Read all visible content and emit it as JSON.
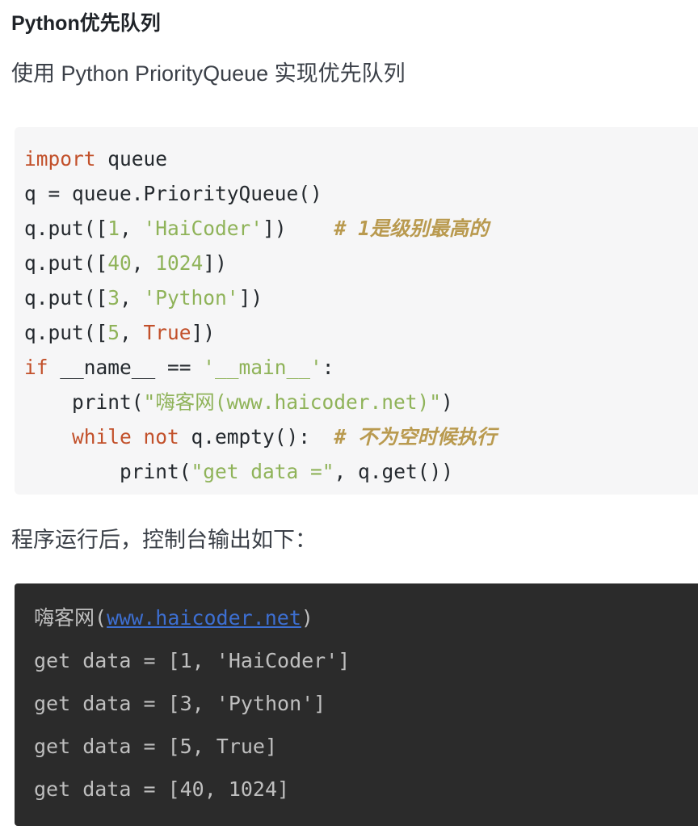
{
  "article": {
    "title": "Python优先队列",
    "lead": "使用 Python PriorityQueue 实现优先队列",
    "run_note": "程序运行后，控制台输出如下："
  },
  "code_block": {
    "language": "python",
    "background": "#f6f6f7",
    "colors": {
      "keyword": "#c2502a",
      "string": "#8fb359",
      "number": "#8fb359",
      "comment": "#b99a4f",
      "plain": "#24292e"
    },
    "lines": [
      {
        "index": 1,
        "text": "import queue",
        "tokens": [
          {
            "t": "import",
            "k": "kw"
          },
          {
            "t": " queue",
            "k": "pln"
          }
        ]
      },
      {
        "index": 2,
        "text": "q = queue.PriorityQueue()",
        "tokens": [
          {
            "t": "q = queue.PriorityQueue()",
            "k": "pln"
          }
        ]
      },
      {
        "index": 3,
        "text": "q.put([1, 'HaiCoder'])    # 1是级别最高的",
        "tokens": [
          {
            "t": "q.put([",
            "k": "pln"
          },
          {
            "t": "1",
            "k": "num"
          },
          {
            "t": ", ",
            "k": "pln"
          },
          {
            "t": "'HaiCoder'",
            "k": "str"
          },
          {
            "t": "])",
            "k": "pln"
          },
          {
            "t": "    ",
            "k": "pln"
          },
          {
            "t": "# 1是级别最高的",
            "k": "com"
          }
        ]
      },
      {
        "index": 4,
        "text": "q.put([40, 1024])",
        "tokens": [
          {
            "t": "q.put([",
            "k": "pln"
          },
          {
            "t": "40",
            "k": "num"
          },
          {
            "t": ", ",
            "k": "pln"
          },
          {
            "t": "1024",
            "k": "num"
          },
          {
            "t": "])",
            "k": "pln"
          }
        ]
      },
      {
        "index": 5,
        "text": "q.put([3, 'Python'])",
        "tokens": [
          {
            "t": "q.put([",
            "k": "pln"
          },
          {
            "t": "3",
            "k": "num"
          },
          {
            "t": ", ",
            "k": "pln"
          },
          {
            "t": "'Python'",
            "k": "str"
          },
          {
            "t": "])",
            "k": "pln"
          }
        ]
      },
      {
        "index": 6,
        "text": "q.put([5, True])",
        "tokens": [
          {
            "t": "q.put([",
            "k": "pln"
          },
          {
            "t": "5",
            "k": "num"
          },
          {
            "t": ", ",
            "k": "pln"
          },
          {
            "t": "True",
            "k": "kw"
          },
          {
            "t": "])",
            "k": "pln"
          }
        ]
      },
      {
        "index": 7,
        "text": "if __name__ == '__main__':",
        "tokens": [
          {
            "t": "if",
            "k": "kw"
          },
          {
            "t": " __name__ == ",
            "k": "pln"
          },
          {
            "t": "'__main__'",
            "k": "str"
          },
          {
            "t": ":",
            "k": "pln"
          }
        ]
      },
      {
        "index": 8,
        "text": "    print(\"嗨客网(www.haicoder.net)\")",
        "tokens": [
          {
            "t": "    print(",
            "k": "pln"
          },
          {
            "t": "\"嗨客网(www.haicoder.net)\"",
            "k": "str"
          },
          {
            "t": ")",
            "k": "pln"
          }
        ]
      },
      {
        "index": 9,
        "text": "    while not q.empty():  # 不为空时候执行",
        "tokens": [
          {
            "t": "    ",
            "k": "pln"
          },
          {
            "t": "while not",
            "k": "kw"
          },
          {
            "t": " q.empty():",
            "k": "pln"
          },
          {
            "t": "  ",
            "k": "pln"
          },
          {
            "t": "# 不为空时候执行",
            "k": "com"
          }
        ]
      },
      {
        "index": 10,
        "text": "        print(\"get data =\", q.get())",
        "tokens": [
          {
            "t": "        print(",
            "k": "pln"
          },
          {
            "t": "\"get data =\"",
            "k": "str"
          },
          {
            "t": ", q.get())",
            "k": "pln"
          }
        ]
      }
    ]
  },
  "console_block": {
    "background": "#2b2b2b",
    "text_color": "#bfbfbf",
    "link_color": "#3d6fd1",
    "lines": [
      {
        "index": 1,
        "prefix": "嗨客网(",
        "link": "www.haicoder.net",
        "suffix": ")"
      },
      {
        "index": 2,
        "prefix": "get data = [1, 'HaiCoder']",
        "link": "",
        "suffix": ""
      },
      {
        "index": 3,
        "prefix": "get data = [3, 'Python']",
        "link": "",
        "suffix": ""
      },
      {
        "index": 4,
        "prefix": "get data = [5, True]",
        "link": "",
        "suffix": ""
      },
      {
        "index": 5,
        "prefix": "get data = [40, 1024]",
        "link": "",
        "suffix": ""
      }
    ]
  }
}
